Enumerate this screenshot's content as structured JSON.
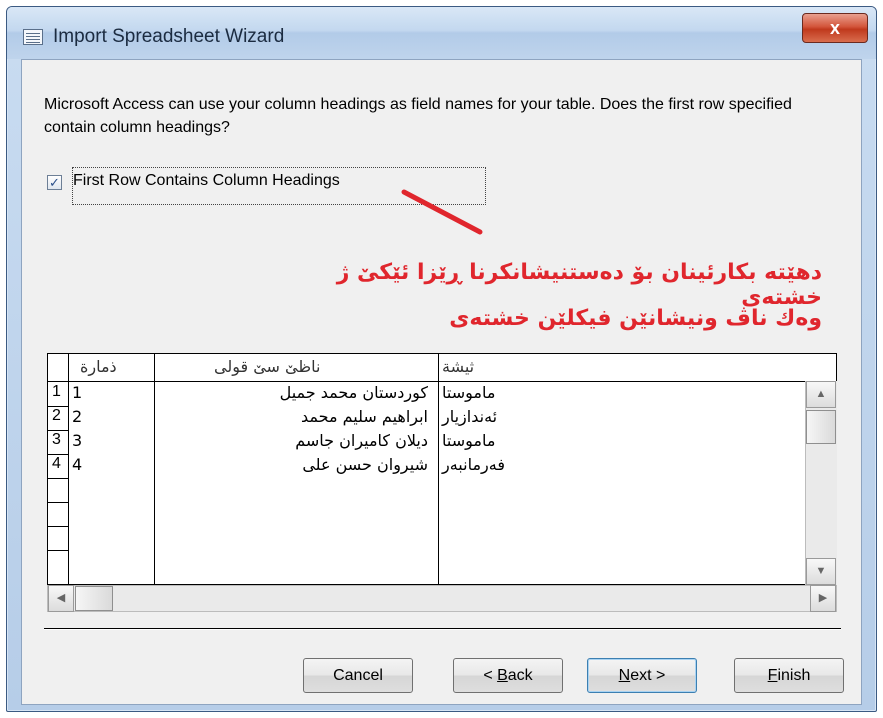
{
  "window": {
    "title": "Import Spreadsheet Wizard",
    "close_label": "x"
  },
  "wizard": {
    "description": "Microsoft Access can use your column headings as field names for your table. Does the first row specified contain column headings?",
    "checkbox": {
      "checked": true,
      "label": "First Row Contains Column Headings"
    }
  },
  "annotation": {
    "line1": "دهێته بكارئینان بۆ دەستنیشانكرنا ڕێزا ئێكێ ژ خشتەی",
    "line2": "وەك ناڤ ونیشانێن فیكلێن خشتەی",
    "color": "#e0262d"
  },
  "grid": {
    "headers": [
      "ذمارة",
      "ناظێ سێ قولی",
      "ثیشة"
    ],
    "rows": [
      [
        "1",
        "1",
        "كوردستان محمد جمیل",
        "ماموستا"
      ],
      [
        "2",
        "2",
        "ابراهیم سلیم محمد",
        "ئەندازیار"
      ],
      [
        "3",
        "3",
        "دیلان كامیران جاسم",
        "ماموستا"
      ],
      [
        "4",
        "4",
        "شیروان حسن علی",
        "فەرمانبەر"
      ]
    ]
  },
  "buttons": {
    "cancel": "Cancel",
    "back_prefix": "< ",
    "back_mnemonic": "B",
    "back_rest": "ack",
    "next_mnemonic": "N",
    "next_rest": "ext >",
    "finish_mnemonic": "F",
    "finish_rest": "inish"
  }
}
